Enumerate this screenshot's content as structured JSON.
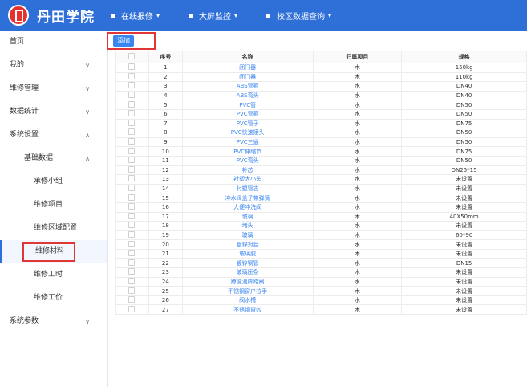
{
  "brand": {
    "name": "丹田学院"
  },
  "topnav": [
    {
      "label": "在线报修"
    },
    {
      "label": "大屏监控"
    },
    {
      "label": "校区数据查询"
    }
  ],
  "sidebar": {
    "home": "首页",
    "mine": "我的",
    "repair_mgmt": "维修管理",
    "data_stats": "数据统计",
    "system_settings": "系统设置",
    "basic_data": "基础数据",
    "sub": [
      "承修小组",
      "维修项目",
      "维修区域配置",
      "维修材料",
      "维修工时",
      "维修工价"
    ],
    "system_params": "系统参数"
  },
  "toolbar": {
    "add_label": "添加"
  },
  "table": {
    "headers": [
      "序号",
      "名称",
      "归属项目",
      "规格"
    ],
    "rows": [
      [
        "1",
        "闭门器",
        "木",
        "150kg"
      ],
      [
        "2",
        "闭门器",
        "木",
        "110kg"
      ],
      [
        "3",
        "ABS管箍",
        "水",
        "DN40"
      ],
      [
        "4",
        "ABS弯头",
        "水",
        "DN40"
      ],
      [
        "5",
        "PVC管",
        "水",
        "DN50"
      ],
      [
        "6",
        "PVC管箍",
        "水",
        "DN50"
      ],
      [
        "7",
        "PVC管子",
        "水",
        "DN75"
      ],
      [
        "8",
        "PVC快速接头",
        "水",
        "DN50"
      ],
      [
        "9",
        "PVC三通",
        "水",
        "DN50"
      ],
      [
        "10",
        "PVC伸缩节",
        "水",
        "DN75"
      ],
      [
        "11",
        "PVC弯头",
        "水",
        "DN50"
      ],
      [
        "12",
        "补芯",
        "水",
        "DN25*15"
      ],
      [
        "13",
        "衬塑大小头",
        "水",
        "未设置"
      ],
      [
        "14",
        "衬塑管古",
        "水",
        "未设置"
      ],
      [
        "15",
        "冲水阀盖子带弹簧",
        "水",
        "未设置"
      ],
      [
        "16",
        "大便冲洗阀",
        "水",
        "未设置"
      ],
      [
        "17",
        "玻璃",
        "木",
        "40X50mm"
      ],
      [
        "18",
        "堵头",
        "水",
        "未设置"
      ],
      [
        "19",
        "玻璃",
        "木",
        "60*90"
      ],
      [
        "20",
        "镀锌对丝",
        "水",
        "未设置"
      ],
      [
        "21",
        "玻璃胶",
        "木",
        "未设置"
      ],
      [
        "22",
        "镀锌钢管",
        "水",
        "DN15"
      ],
      [
        "23",
        "玻璃压条",
        "木",
        "未设置"
      ],
      [
        "24",
        "蹲便池脚踏阀",
        "水",
        "未设置"
      ],
      [
        "25",
        "不锈钢窗户拉手",
        "木",
        "未设置"
      ],
      [
        "26",
        "阀水槽",
        "水",
        "未设置"
      ],
      [
        "27",
        "不锈钢窗纱",
        "木",
        "未设置"
      ]
    ]
  }
}
